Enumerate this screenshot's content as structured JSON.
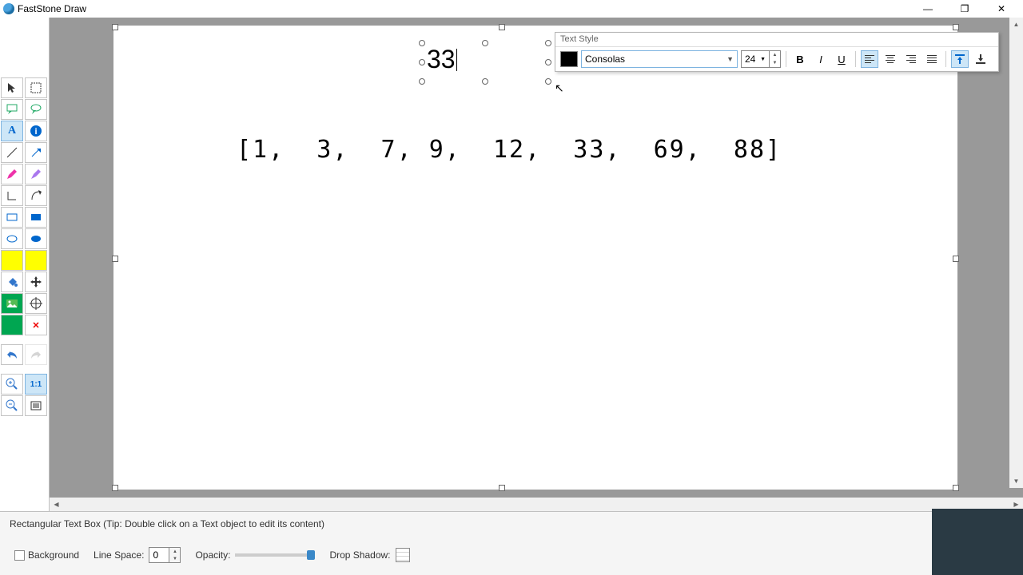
{
  "title": {
    "app_name": "FastStone Draw"
  },
  "window_buttons": {
    "minimize": "—",
    "maximize": "❐",
    "close": "✕"
  },
  "text_style_panel": {
    "title": "Text Style",
    "font_name": "Consolas",
    "font_size": "24",
    "bold": "B",
    "italic": "I",
    "underline": "U"
  },
  "canvas": {
    "active_text": "33",
    "static_text": "[1,  3,  7, 9,  12,  33,  69,  88]"
  },
  "bottom": {
    "tip": "Rectangular Text Box (Tip: Double click on a Text object to edit its content)",
    "background_label": "Background",
    "linespace_label": "Line Space:",
    "linespace_value": "0",
    "opacity_label": "Opacity:",
    "dropshadow_label": "Drop Shadow:"
  },
  "zoom": {
    "ratio11": "1:1"
  }
}
